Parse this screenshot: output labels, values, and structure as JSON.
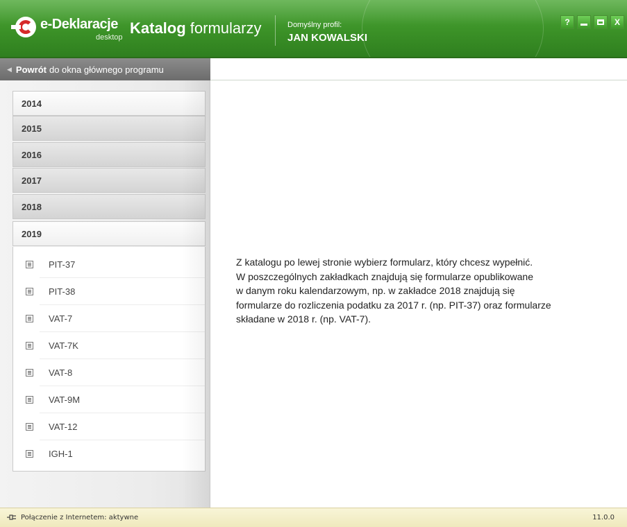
{
  "header": {
    "brand": "e-Deklaracje",
    "brand_sub": "desktop",
    "title_bold": "Katalog",
    "title_rest": " formularzy",
    "profile_label": "Domyślny profil:",
    "profile_name": "JAN KOWALSKI",
    "window_buttons": {
      "help": "?",
      "minimize": "minimize-icon",
      "maximize": "maximize-icon",
      "close": "X"
    }
  },
  "back": {
    "bold": "Powrót",
    "rest": " do okna głównego programu"
  },
  "sidebar": {
    "years": [
      {
        "label": "2014"
      },
      {
        "label": "2015"
      },
      {
        "label": "2016"
      },
      {
        "label": "2017"
      },
      {
        "label": "2018"
      },
      {
        "label": "2019"
      }
    ],
    "forms": [
      {
        "label": "PIT-37"
      },
      {
        "label": "PIT-38"
      },
      {
        "label": "VAT-7"
      },
      {
        "label": "VAT-7K"
      },
      {
        "label": "VAT-8"
      },
      {
        "label": "VAT-9M"
      },
      {
        "label": "VAT-12"
      },
      {
        "label": "IGH-1"
      }
    ]
  },
  "main": {
    "lines": [
      "Z katalogu po lewej stronie wybierz formularz, który chcesz wypełnić.",
      "W poszczególnych zakładkach znajdują się formularze opublikowane",
      "w danym roku kalendarzowym, np. w zakładce 2018 znajdują się",
      "formularze do rozliczenia podatku za 2017 r. (np. PIT-37) oraz formularze",
      "składane w 2018 r. (np. VAT-7)."
    ]
  },
  "status": {
    "connection": "Połączenie z Internetem: aktywne",
    "version": "11.0.0"
  },
  "colors": {
    "titlebar_green": "#3b9127",
    "logo_red": "#d62a2a",
    "statusbar": "#f3eec9"
  }
}
